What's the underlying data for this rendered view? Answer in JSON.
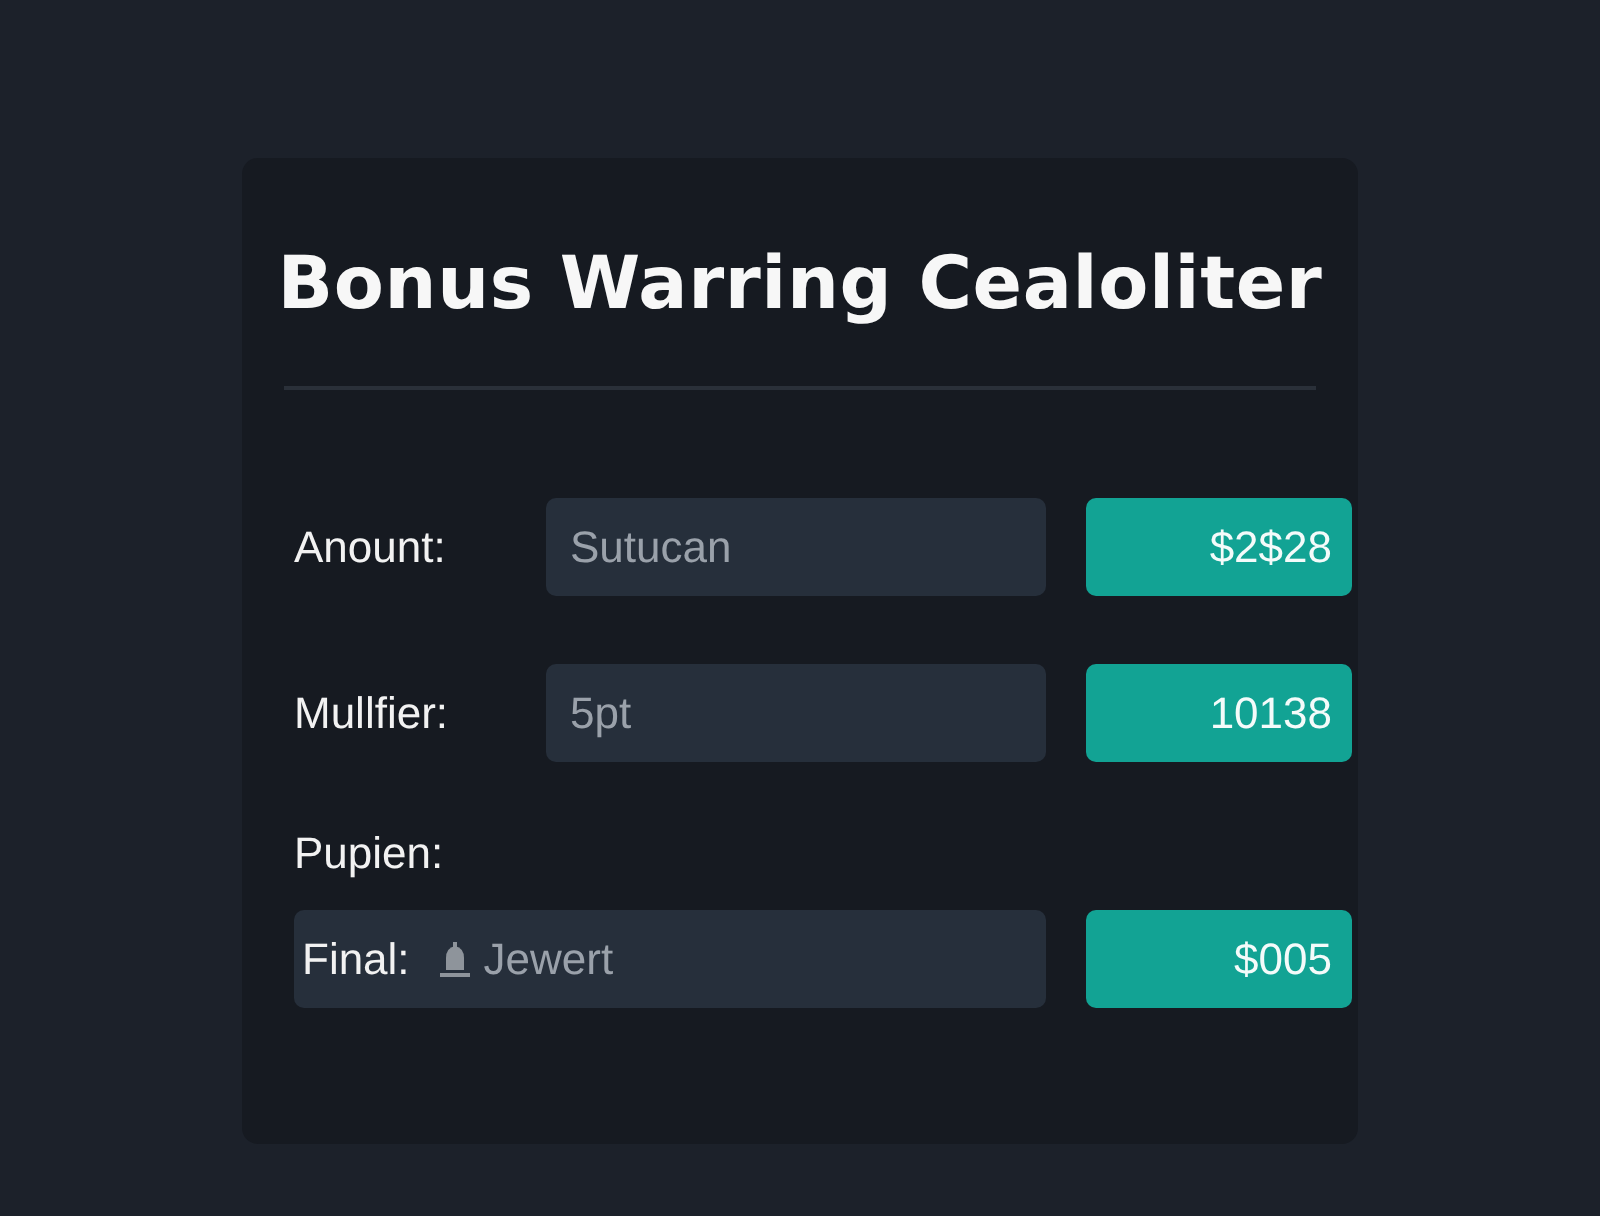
{
  "title": "Bonus Warring Cealoliter",
  "rows": [
    {
      "kind": "field",
      "label": "Anount:",
      "placeholder": "Sutucan",
      "result": "$2$28"
    },
    {
      "kind": "field",
      "label": "Mullfier:",
      "placeholder": "5pt",
      "result": "10138"
    },
    {
      "kind": "heading",
      "label": "Pupien:"
    },
    {
      "kind": "inline",
      "label": "Final:",
      "placeholder": "Jewert",
      "result": "$005"
    }
  ]
}
